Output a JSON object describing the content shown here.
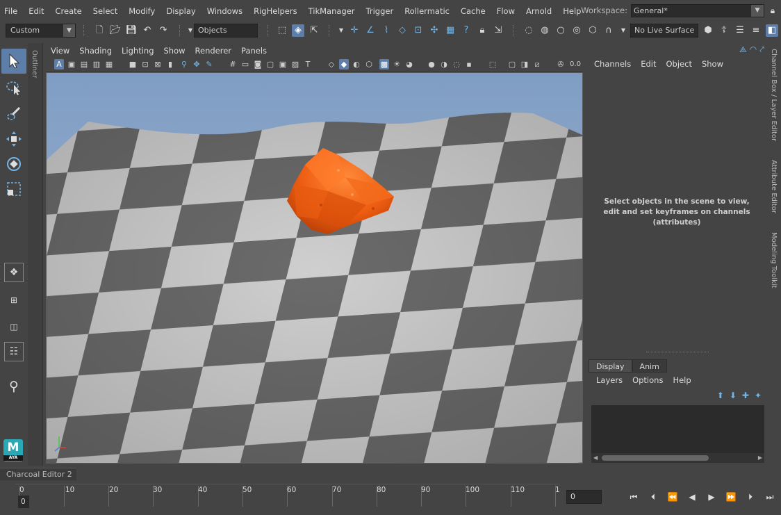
{
  "menubar": {
    "items": [
      "File",
      "Edit",
      "Create",
      "Select",
      "Modify",
      "Display",
      "Windows",
      "RigHelpers",
      "TikManager",
      "Trigger",
      "Rollermatic",
      "Cache",
      "Flow",
      "Arnold",
      "Help"
    ],
    "workspace_label": "Workspace:",
    "workspace_value": "General*"
  },
  "statusline": {
    "menu_set": "Custom",
    "selection_mask": "Objects",
    "live_surface": "No Live Surface"
  },
  "outliner": {
    "label": "Outliner"
  },
  "viewport": {
    "menu": [
      "View",
      "Shading",
      "Lighting",
      "Show",
      "Renderer",
      "Panels"
    ],
    "field_value": "0.0"
  },
  "channel_box": {
    "menu": [
      "Channels",
      "Edit",
      "Object",
      "Show"
    ],
    "hint": "Select objects in the scene to view, edit and set keyframes on channels (attributes)"
  },
  "layer_editor": {
    "tabs": [
      "Display",
      "Anim"
    ],
    "menu": [
      "Layers",
      "Options",
      "Help"
    ]
  },
  "right_tabs": [
    "Channel Box / Layer Editor",
    "Attribute Editor",
    "Modeling Toolkit"
  ],
  "bottom": {
    "editor_tab": "Charcoal Editor 2",
    "ticks": [
      "0",
      "10",
      "20",
      "30",
      "40",
      "50",
      "60",
      "70",
      "80",
      "90",
      "100",
      "110",
      "1"
    ],
    "current_frame_marker": "0",
    "current_time": "0"
  },
  "logo": {
    "text": "M",
    "sub": "AYA"
  },
  "colors": {
    "accent_blue": "#5d7ea8",
    "icon_blue": "#74b3e3",
    "rock_orange": "#ee5d12",
    "sky": "#8aa4c6"
  }
}
